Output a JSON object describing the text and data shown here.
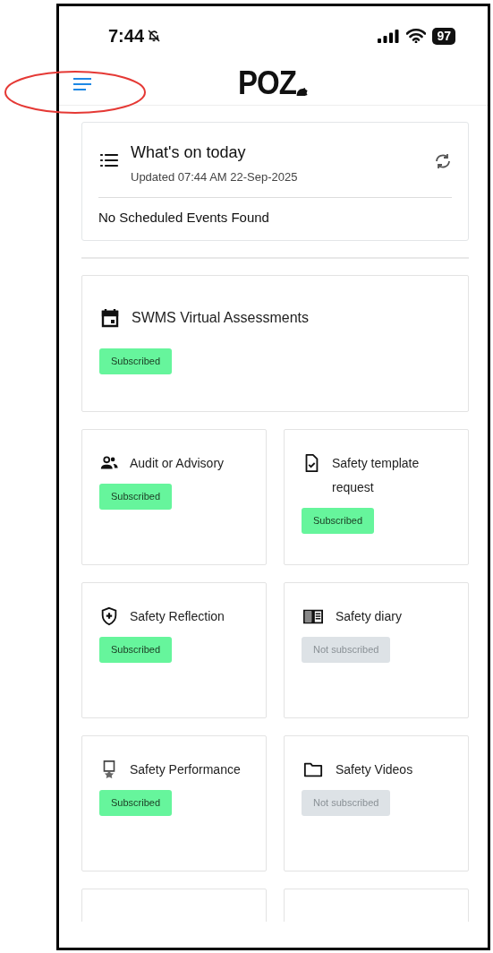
{
  "status_bar": {
    "time": "7:44",
    "battery": "97"
  },
  "header": {
    "logo": "POZ"
  },
  "today": {
    "title": "What's on today",
    "updated": "Updated 07:44 AM 22-Sep-2025",
    "message": "No Scheduled Events Found"
  },
  "featured": {
    "title": "SWMS Virtual Assessments",
    "status": "Subscribed",
    "subscribed": true
  },
  "services": [
    {
      "title": "Audit or Advisory",
      "status": "Subscribed",
      "subscribed": true
    },
    {
      "title": "Safety template request",
      "status": "Subscribed",
      "subscribed": true
    },
    {
      "title": "Safety Reflection",
      "status": "Subscribed",
      "subscribed": true
    },
    {
      "title": "Safety diary",
      "status": "Not subscribed",
      "subscribed": false
    },
    {
      "title": "Safety Performance",
      "status": "Subscribed",
      "subscribed": true
    },
    {
      "title": "Safety Videos",
      "status": "Not subscribed",
      "subscribed": false
    }
  ]
}
